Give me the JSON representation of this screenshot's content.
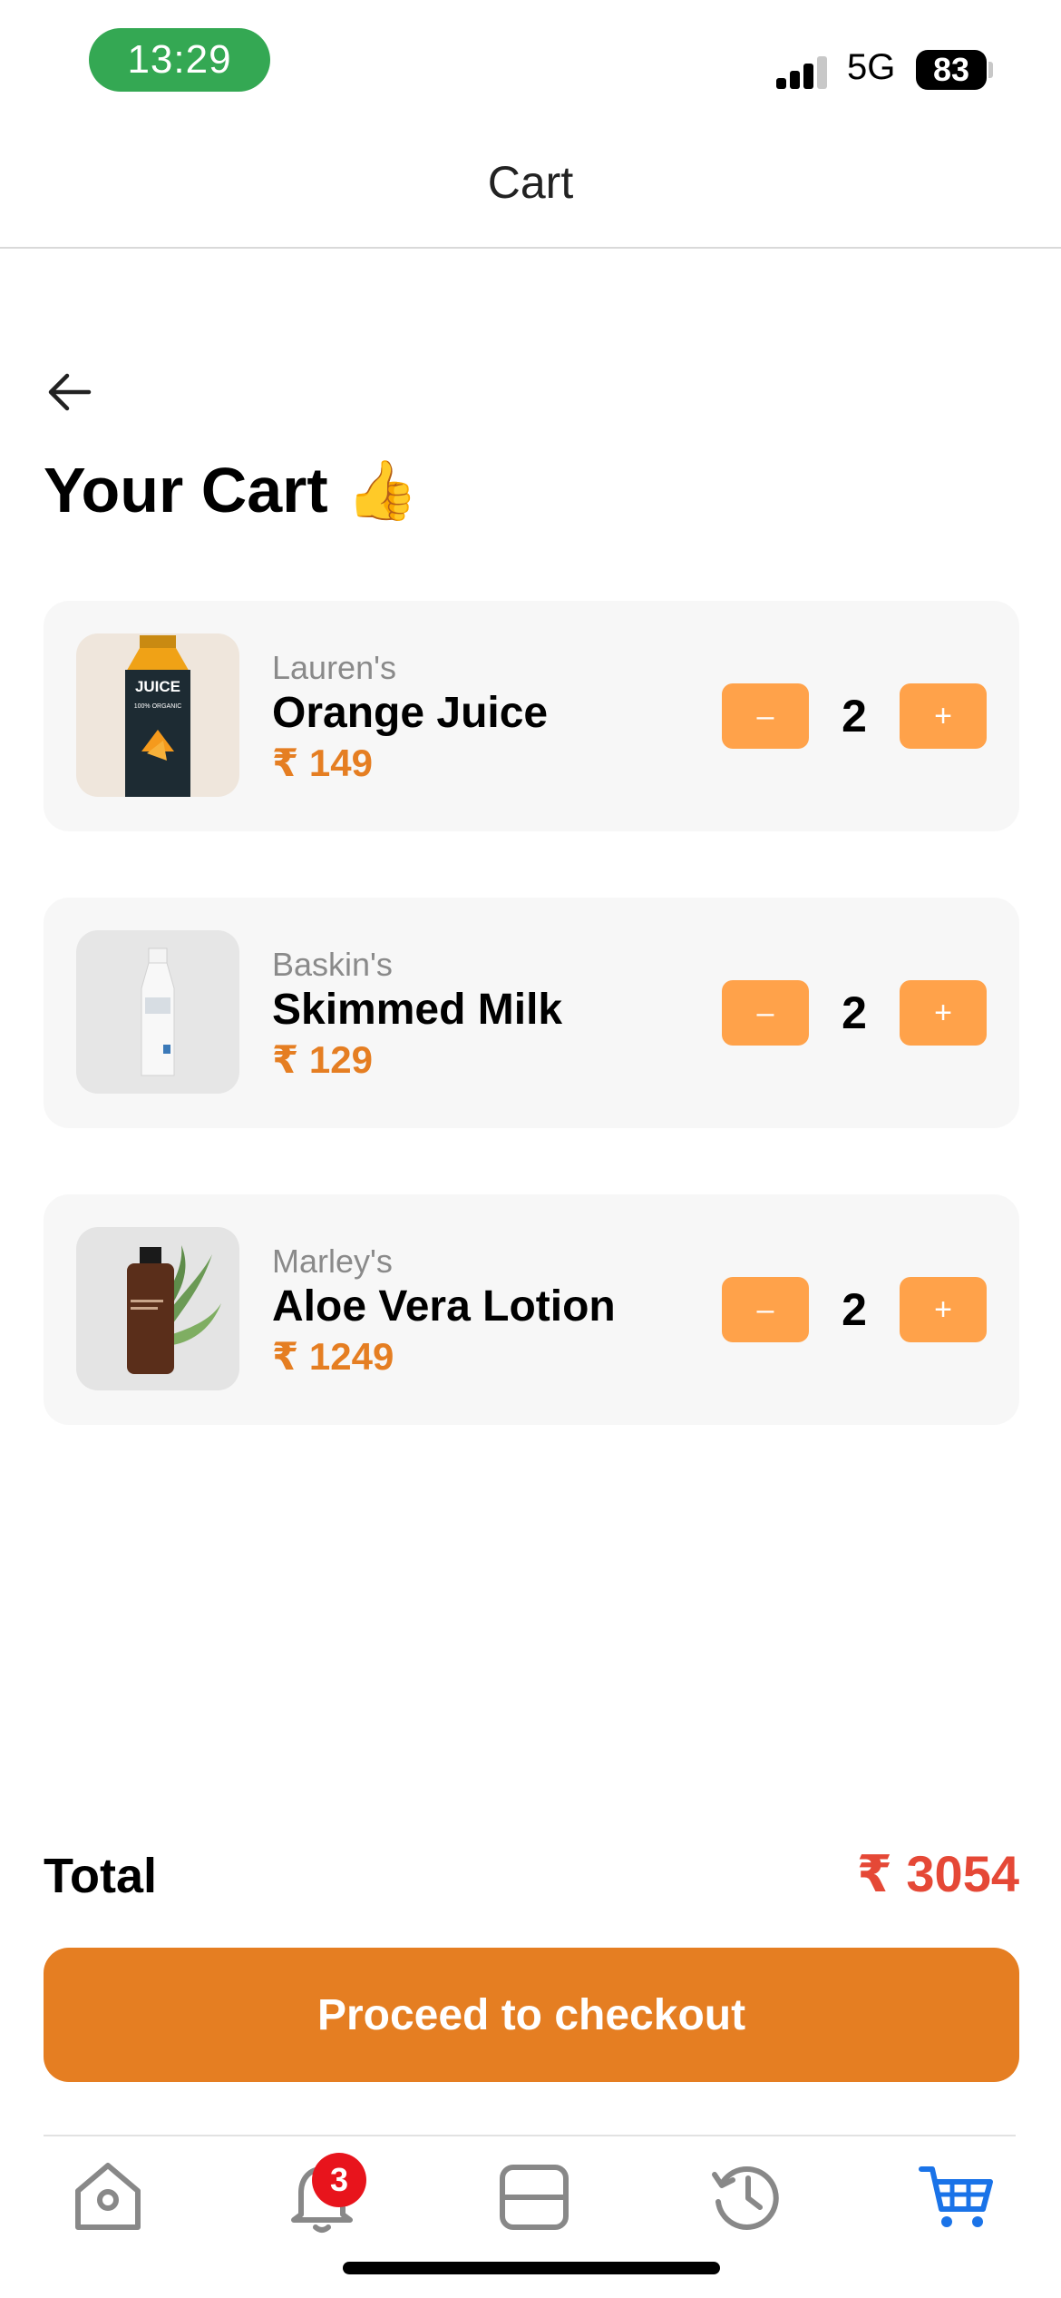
{
  "status_bar": {
    "time": "13:29",
    "network": "5G",
    "battery": "83"
  },
  "header": {
    "title": "Cart"
  },
  "page": {
    "title": "Your Cart",
    "title_emoji": "👍"
  },
  "cart_items": [
    {
      "brand": "Lauren's",
      "name": "Orange Juice",
      "price": "₹ 149",
      "quantity": "2",
      "image": "orange-juice-bottle"
    },
    {
      "brand": "Baskin's",
      "name": "Skimmed Milk",
      "price": "₹ 129",
      "quantity": "2",
      "image": "milk-bottle"
    },
    {
      "brand": "Marley's",
      "name": "Aloe Vera Lotion",
      "price": "₹ 1249",
      "quantity": "2",
      "image": "lotion-bottle"
    }
  ],
  "controls": {
    "decrement": "–",
    "increment": "+"
  },
  "product_label": {
    "juice_line1": "JUICE",
    "juice_line2": "100% ORGANIC"
  },
  "summary": {
    "total_label": "Total",
    "total_value": "₹ 3054",
    "checkout_label": "Proceed to checkout"
  },
  "tabbar": {
    "tabs": [
      "home-icon",
      "bell-icon",
      "wallet-icon",
      "history-icon",
      "cart-icon"
    ],
    "active": "cart-icon",
    "notification_count": "3"
  },
  "colors": {
    "accent": "#e57e22",
    "qty_button": "#ffa24a",
    "total": "#e54836",
    "active_tab": "#1a73e8",
    "time_pill": "#34a853",
    "badge": "#e8141c"
  }
}
